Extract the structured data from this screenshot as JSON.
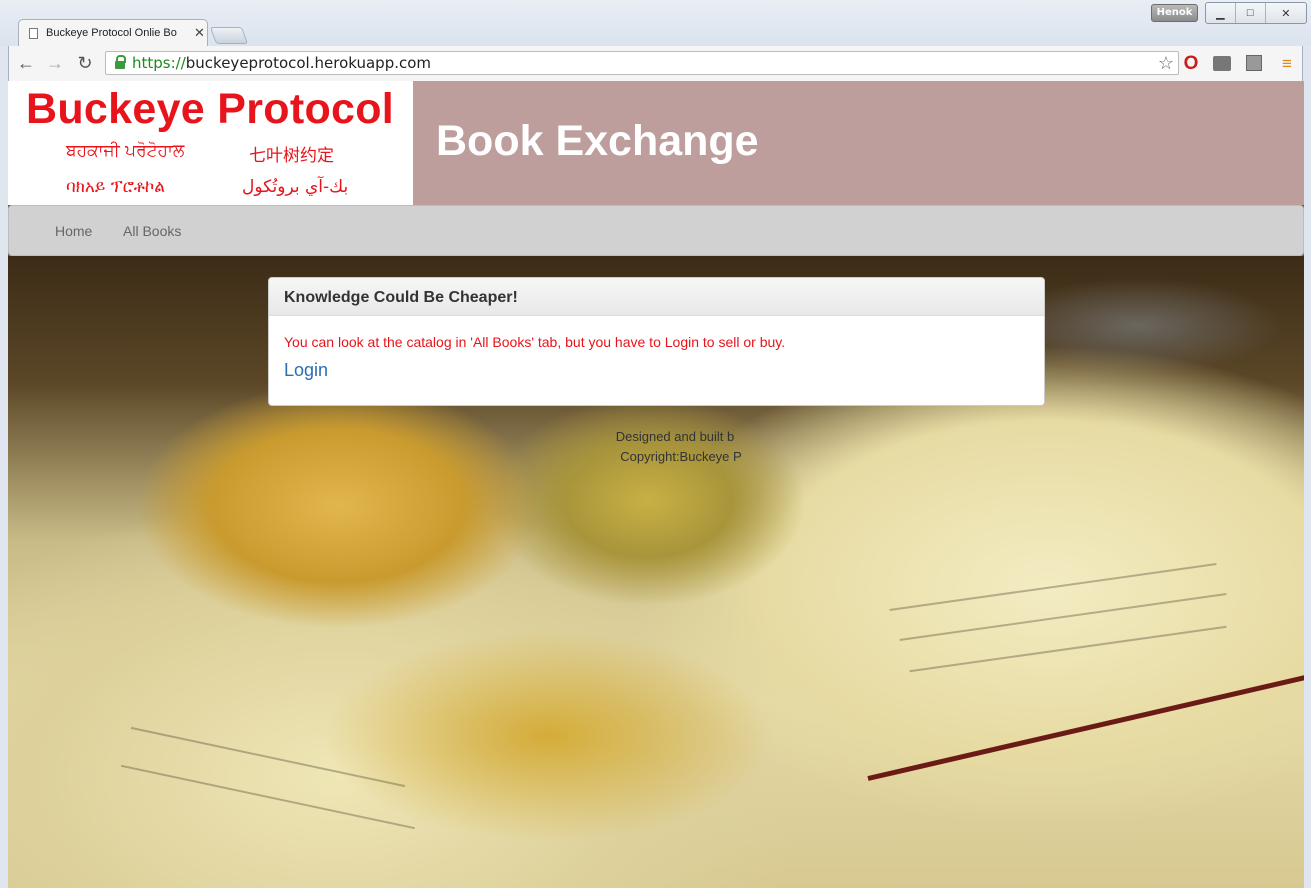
{
  "browser": {
    "user_badge": "Henok",
    "tab_title": "Buckeye Protocol Onlie Bo",
    "tab_close": "✕",
    "url_scheme": "https://",
    "url_host": "buckeyeprotocol.herokuapp.com",
    "window_controls": {
      "minimize": "▁",
      "maximize": "□",
      "close": "✕"
    }
  },
  "header": {
    "logo_title": "Buckeye Protocol",
    "logo_sub_1": "ਬਹਕਾਜੀ ਪਰੋਟੋਹਾਲ",
    "logo_sub_2": "七叶树约定",
    "logo_sub_3": "ባክአይ ፕሮቶኮል",
    "logo_sub_4": "بك-آي بروتُكول",
    "banner_title": "Book Exchange"
  },
  "nav": {
    "items": [
      {
        "label": "Home"
      },
      {
        "label": "All Books"
      }
    ]
  },
  "panel": {
    "title": "Knowledge Could Be Cheaper!",
    "message": "You can look at the catalog in 'All Books' tab, but you have to Login to sell or buy.",
    "login_link": "Login"
  },
  "footer": {
    "line1": "Designed and built b",
    "line2": "Copyright:Buckeye P"
  },
  "colors": {
    "brand_red": "#e8141b",
    "banner_bg": "#be9d9d",
    "navbar_bg": "#d1d1d1",
    "link_blue": "#2a6fb0"
  }
}
